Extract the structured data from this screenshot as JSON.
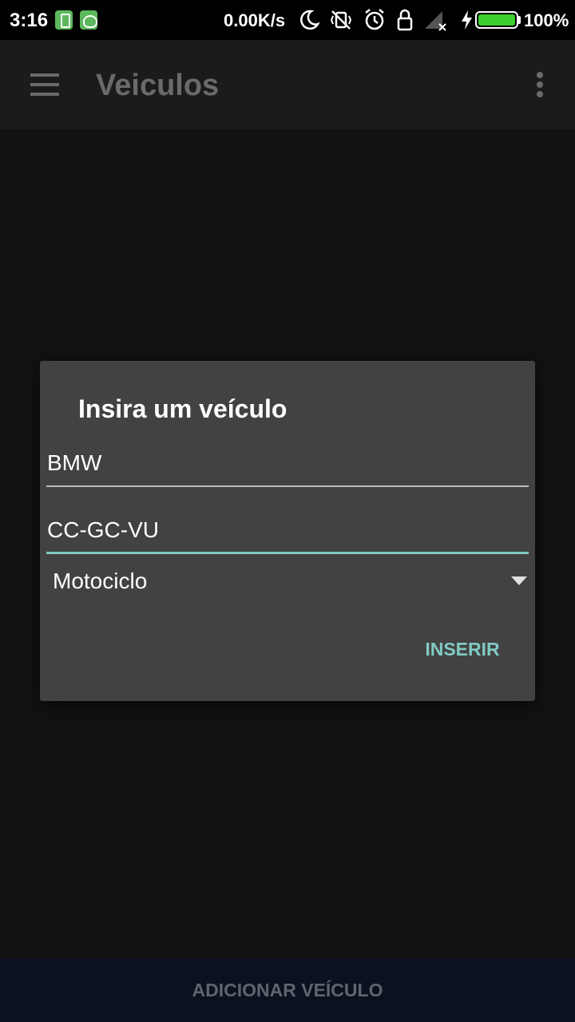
{
  "status_bar": {
    "time": "3:16",
    "network_speed": "0.00K/s",
    "battery_percent": "100%",
    "battery_level": 1.0,
    "icons": [
      "battery-notification-icon",
      "android-notification-icon",
      "moon-icon",
      "vibrate-off-icon",
      "alarm-icon",
      "lock-rotation-icon",
      "signal-icon",
      "charging-icon",
      "battery-icon"
    ]
  },
  "app_bar": {
    "title": "Veiculos",
    "menu_icon": "hamburger-menu-icon",
    "overflow_icon": "more-vertical-icon"
  },
  "dialog": {
    "title": "Insira um veículo",
    "brand_value": "BMW",
    "plate_value": "CC-GC-VU",
    "type_selected": "Motociclo",
    "insert_label": "INSERIR"
  },
  "bottom_bar": {
    "add_label": "ADICIONAR VEÍCULO"
  },
  "colors": {
    "accent": "#80cbc4",
    "dialog_bg": "#424242",
    "background": "#121212",
    "battery": "#3ccf2e"
  }
}
